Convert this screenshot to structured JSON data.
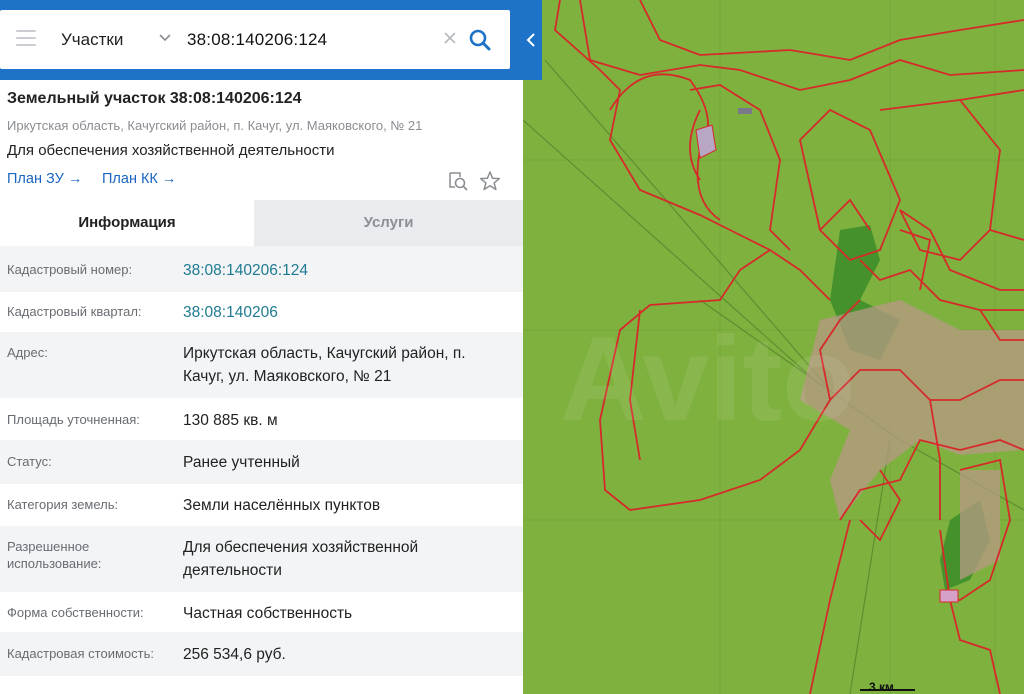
{
  "search": {
    "layer": "Участки",
    "query": "38:08:140206:124"
  },
  "parcel": {
    "title": "Земельный участок 38:08:140206:124",
    "address_line": "Иркутская область, Качугский район, п. Качуг, ул. Маяковского, № 21",
    "usage_line": "Для обеспечения хозяйственной деятельности",
    "links": [
      "План ЗУ →",
      "План КК →"
    ]
  },
  "tabs": [
    "Информация",
    "Услуги"
  ],
  "info": {
    "cadastral_number": {
      "label": "Кадастровый номер:",
      "value": "38:08:140206:124"
    },
    "cadastral_quarter": {
      "label": "Кадастровый квартал:",
      "value": "38:08:140206"
    },
    "address": {
      "label": "Адрес:",
      "value_line1": "Иркутская область, Качугский район, п.",
      "value_line2": "Качуг, ул. Маяковского, № 21"
    },
    "area": {
      "label": "Площадь уточненная:",
      "value": "130 885 кв. м"
    },
    "status": {
      "label": "Статус:",
      "value": "Ранее учтенный"
    },
    "category": {
      "label": "Категория земель:",
      "value": "Земли населённых пунктов"
    },
    "permitted_use": {
      "label_line1": "Разрешенное",
      "label_line2": "использование:",
      "value_line1": "Для обеспечения хозяйственной",
      "value_line2": "деятельности"
    },
    "ownership": {
      "label": "Форма собственности:",
      "value": "Частная собственность"
    },
    "cadastral_value": {
      "label": "Кадастровая стоимость:",
      "value": "256 534,6 руб."
    }
  },
  "map": {
    "scale_label": "3 км",
    "colors": {
      "land": "#7fb13f",
      "forest": "#3f8f2a",
      "boundary": "#d62a2a",
      "settlement": "#b79a84"
    }
  }
}
